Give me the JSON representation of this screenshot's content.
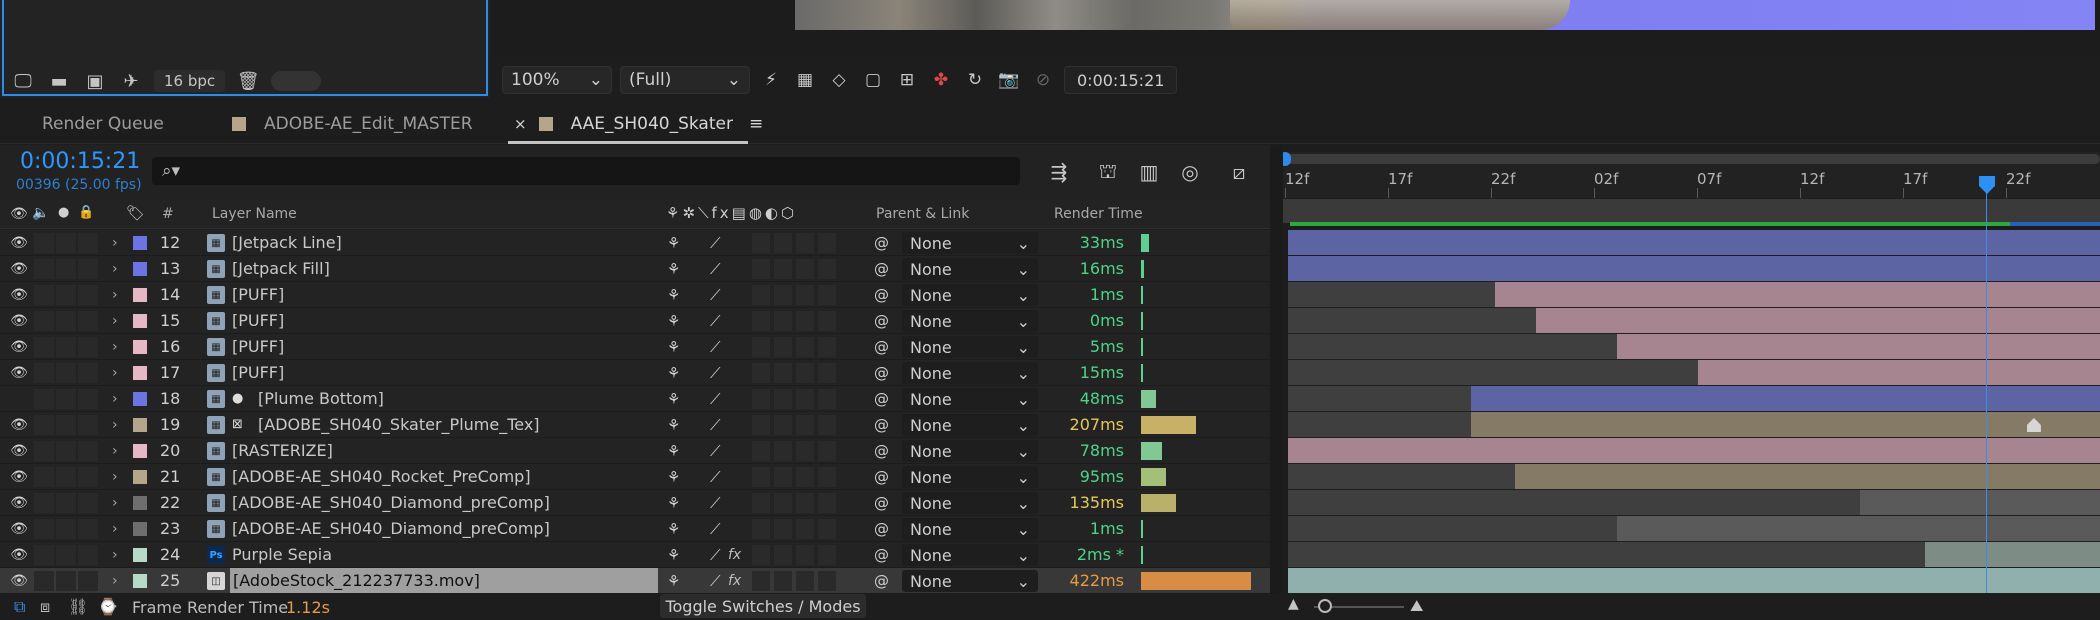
{
  "project_panel": {
    "bpc_label": "16 bpc",
    "footer_icons": [
      "interpret-footage-icon",
      "new-folder-icon",
      "new-composition-icon",
      "render-queue-icon"
    ],
    "trash_icon": "trash-icon"
  },
  "viewer": {
    "zoom": "100%",
    "resolution": "(Full)",
    "timecode": "0:00:15:21",
    "icons": [
      "fast-previews-icon",
      "transparency-grid-icon",
      "mask-visibility-icon",
      "region-of-interest-icon",
      "guides-icon",
      "color-channels-icon",
      "exposure-icon",
      "snapshot-icon",
      "show-snapshot-icon"
    ]
  },
  "tabs": [
    {
      "label": "Render Queue",
      "close": "",
      "color": ""
    },
    {
      "label": "ADOBE-AE_Edit_MASTER",
      "close": "",
      "color": "#b5a58a"
    },
    {
      "label": "AAE_SH040_Skater",
      "close": "×",
      "color": "#b5a58a",
      "menu": "≡"
    }
  ],
  "comp": {
    "current_time": "0:00:15:21",
    "frame_info": "00396 (25.00 fps)",
    "search_placeholder": "⌕▾"
  },
  "ruler_ticks": [
    "12f",
    "17f",
    "22f",
    "02f",
    "07f",
    "12f",
    "17f",
    "22f"
  ],
  "columns": {
    "hash": "#",
    "layer_name": "Layer Name",
    "parent_link": "Parent & Link",
    "render_time": "Render Time"
  },
  "colors": {
    "accent_blue": "#2e97ff",
    "render_green": "#4fd28a",
    "render_yellow": "#e6c85a",
    "render_orange": "#e89a45"
  },
  "layers": [
    {
      "num": "12",
      "name": "[Jetpack Line]",
      "label": "#6b74e0",
      "parent": "None",
      "rt": "33ms",
      "rt_color": "#4fd28a",
      "rt_bar": 0.07,
      "rt_bar_color": "#5dcf90",
      "visible": true,
      "fx": false,
      "type": "comp",
      "bar_color": "#5c64a4",
      "bar_start": 0.0,
      "bar_end": 1.0
    },
    {
      "num": "13",
      "name": "[Jetpack Fill]",
      "label": "#6b74e0",
      "parent": "None",
      "rt": "16ms",
      "rt_color": "#4fd28a",
      "rt_bar": 0.03,
      "rt_bar_color": "#5dcf90",
      "visible": true,
      "fx": false,
      "type": "comp",
      "bar_color": "#5c64a4",
      "bar_start": 0.0,
      "bar_end": 1.0
    },
    {
      "num": "14",
      "name": "[PUFF]",
      "label": "#e6b8c6",
      "parent": "None",
      "rt": "1ms",
      "rt_color": "#4fd28a",
      "rt_bar": 0.01,
      "rt_bar_color": "#5dcf90",
      "visible": true,
      "fx": false,
      "type": "comp",
      "bar_color": "#a68590",
      "bar_start": 0.255,
      "bar_end": 1.0
    },
    {
      "num": "15",
      "name": "[PUFF]",
      "label": "#e6b8c6",
      "parent": "None",
      "rt": "0ms",
      "rt_color": "#4fd28a",
      "rt_bar": 0.0,
      "rt_bar_color": "#5dcf90",
      "visible": true,
      "fx": false,
      "type": "comp",
      "bar_color": "#a68590",
      "bar_start": 0.305,
      "bar_end": 1.0
    },
    {
      "num": "16",
      "name": "[PUFF]",
      "label": "#e6b8c6",
      "parent": "None",
      "rt": "5ms",
      "rt_color": "#4fd28a",
      "rt_bar": 0.01,
      "rt_bar_color": "#5dcf90",
      "visible": true,
      "fx": false,
      "type": "comp",
      "bar_color": "#a68590",
      "bar_start": 0.405,
      "bar_end": 1.0
    },
    {
      "num": "17",
      "name": "[PUFF]",
      "label": "#e6b8c6",
      "parent": "None",
      "rt": "15ms",
      "rt_color": "#4fd28a",
      "rt_bar": 0.02,
      "rt_bar_color": "#5dcf90",
      "visible": true,
      "fx": false,
      "type": "comp",
      "bar_color": "#a68590",
      "bar_start": 0.505,
      "bar_end": 1.0
    },
    {
      "num": "18",
      "name": "[Plume Bottom]",
      "label": "#6b74e0",
      "parent": "None",
      "rt": "48ms",
      "rt_color": "#4fd28a",
      "rt_bar": 0.14,
      "rt_bar_color": "#82c894",
      "visible": false,
      "fx": false,
      "type": "comp",
      "matte": "●",
      "bar_color": "#5c64a4",
      "bar_start": 0.225,
      "bar_end": 1.0
    },
    {
      "num": "19",
      "name": "[ADOBE_SH040_Skater_Plume_Tex]",
      "label": "#b5a58a",
      "parent": "None",
      "rt": "207ms",
      "rt_color": "#e6c85a",
      "rt_bar": 0.5,
      "rt_bar_color": "#c8b066",
      "visible": true,
      "fx": false,
      "type": "comp",
      "matte": "⊠",
      "bar_color": "#857a66",
      "bar_start": 0.225,
      "bar_end": 1.0,
      "keyframe": 0.91
    },
    {
      "num": "20",
      "name": "[RASTERIZE]",
      "label": "#e6b8c6",
      "parent": "None",
      "rt": "78ms",
      "rt_color": "#4fd28a",
      "rt_bar": 0.19,
      "rt_bar_color": "#82c894",
      "visible": true,
      "fx": false,
      "type": "comp",
      "bar_color": "#a68590",
      "bar_start": 0.0,
      "bar_end": 1.0
    },
    {
      "num": "21",
      "name": "[ADOBE-AE_SH040_Rocket_PreComp]",
      "label": "#b5a58a",
      "parent": "None",
      "rt": "95ms",
      "rt_color": "#4fd28a",
      "rt_bar": 0.23,
      "rt_bar_color": "#a4bf78",
      "visible": true,
      "fx": false,
      "type": "comp",
      "bar_color": "#857a66",
      "bar_start": 0.28,
      "bar_end": 1.0
    },
    {
      "num": "22",
      "name": "[ADOBE-AE_SH040_Diamond_preComp]",
      "label": "#6e6e6e",
      "parent": "None",
      "rt": "135ms",
      "rt_color": "#e6c85a",
      "rt_bar": 0.32,
      "rt_bar_color": "#b9b06a",
      "visible": true,
      "fx": false,
      "type": "comp",
      "bar_color": "#5a5a5a",
      "bar_start": 0.705,
      "bar_end": 1.0
    },
    {
      "num": "23",
      "name": "[ADOBE-AE_SH040_Diamond_preComp]",
      "label": "#6e6e6e",
      "parent": "None",
      "rt": "1ms",
      "rt_color": "#4fd28a",
      "rt_bar": 0.01,
      "rt_bar_color": "#5dcf90",
      "visible": true,
      "fx": false,
      "type": "comp",
      "bar_color": "#5a5a5a",
      "bar_start": 0.405,
      "bar_end": 1.0
    },
    {
      "num": "24",
      "name": "Purple Sepia",
      "label": "#b8d8c8",
      "parent": "None",
      "rt": "2ms *",
      "rt_color": "#4fd28a",
      "rt_bar": 0.01,
      "rt_bar_color": "#5dcf90",
      "visible": true,
      "fx": true,
      "type": "ps",
      "bar_color": "#7e8c86",
      "bar_start": 0.785,
      "bar_end": 1.0
    },
    {
      "num": "25",
      "name": "[AdobeStock_212237733.mov]",
      "label": "#b8d8c8",
      "parent": "None",
      "rt": "422ms",
      "rt_color": "#e89a45",
      "rt_bar": 1.0,
      "rt_bar_color": "#d88d46",
      "visible": true,
      "fx": true,
      "type": "footage",
      "bar_color": "#8fb0ac",
      "bar_start": 0.0,
      "bar_end": 1.0,
      "selected": true
    }
  ],
  "footer": {
    "frame_render_label": "Frame Render Time",
    "frame_render_value": "1.12s",
    "toggle_label": "Toggle Switches / Modes"
  }
}
